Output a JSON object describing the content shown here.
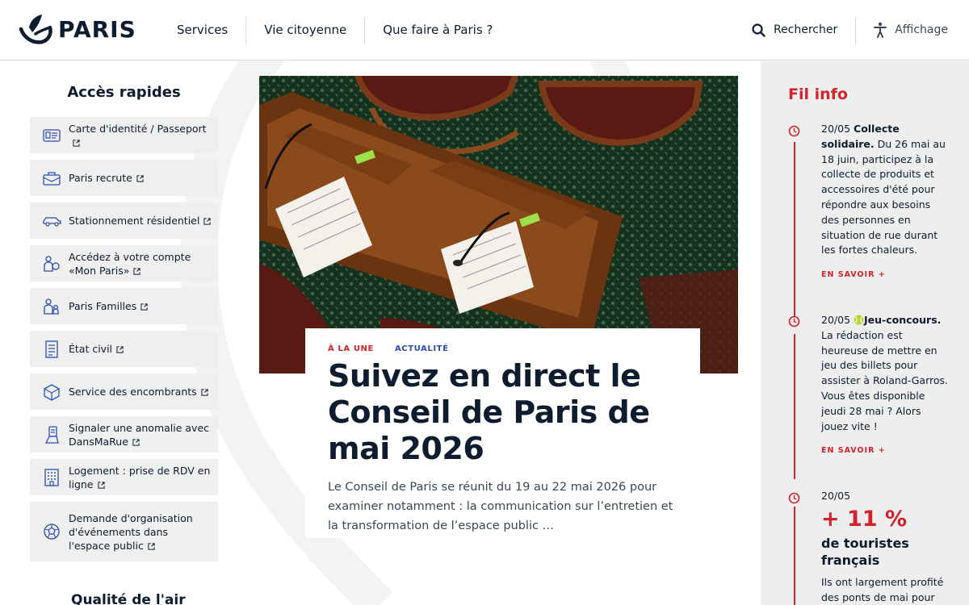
{
  "header": {
    "logo_text": "PARIS",
    "nav": [
      "Services",
      "Vie citoyenne",
      "Que faire à Paris ?"
    ],
    "search_label": "Rechercher",
    "display_label": "Affichage"
  },
  "quick_access": {
    "title": "Accès rapides",
    "items": [
      {
        "label": "Carte d'identité / Passeport",
        "icon": "id-card-icon"
      },
      {
        "label": "Paris recrute",
        "icon": "briefcase-icon"
      },
      {
        "label": "Stationnement résidentiel",
        "icon": "car-icon"
      },
      {
        "label": "Accédez à votre compte «Mon Paris»",
        "icon": "account-icon"
      },
      {
        "label": "Paris Familles",
        "icon": "family-icon"
      },
      {
        "label": "État civil",
        "icon": "document-icon"
      },
      {
        "label": "Service des encombrants",
        "icon": "box-icon"
      },
      {
        "label": "Signaler une anomalie avec DansMaRue",
        "icon": "report-icon"
      },
      {
        "label": "Logement : prise de RDV en ligne",
        "icon": "building-icon"
      },
      {
        "label": "Demande d'organisation d'événements dans l'espace public",
        "icon": "ball-icon"
      }
    ],
    "air_title": "Qualité de l'air"
  },
  "feature": {
    "tag_primary": "À LA UNE",
    "tag_secondary": "ACTUALITÉ",
    "title": "Suivez en direct le Conseil de Paris de mai 2026",
    "description": "Le Conseil de Paris se réunit du 19 au 22 mai 2026 pour examiner notamment : la communication sur l’entretien et la transformation de l’espace public …"
  },
  "feed": {
    "title": "Fil info",
    "entries": [
      {
        "date": "20/05",
        "headline": "Collecte solidaire.",
        "text": "Du 26 mai au 18 juin, participez à la collecte de produits et accessoires d'été pour répondre aux besoins des personnes en situation de rue durant les fortes chaleurs.",
        "more": "EN SAVOIR +"
      },
      {
        "date": "20/05",
        "headline": "Jeu-concours.",
        "text": "La rédaction est heureuse de mettre en jeu des billets pour assister à Roland-Garros. Vous êtes disponible jeudi 28 mai ? Alors jouez vite !",
        "more": "EN SAVOIR +"
      },
      {
        "date": "20/05",
        "stat": "+ 11 %",
        "stat_label": "de touristes français",
        "text": "Ils ont largement profité des ponts de mai pour"
      }
    ]
  },
  "colors": {
    "accent_red": "#d2232a",
    "navy": "#0d1c2e",
    "tag_blue": "#2a4bb4",
    "tile_gray": "#efefef",
    "feed_gray": "#eeeeee"
  }
}
